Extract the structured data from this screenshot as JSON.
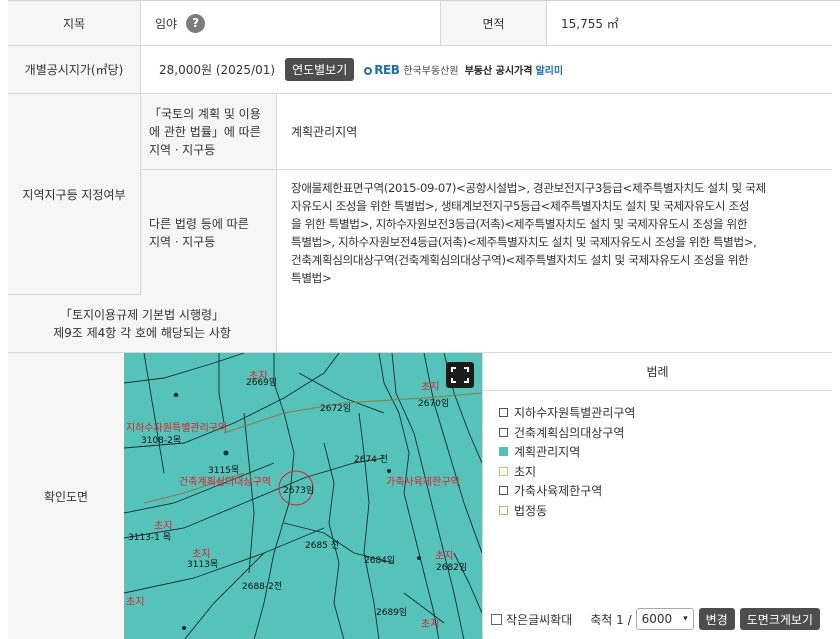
{
  "row1": {
    "label_jimok": "지목",
    "jimok_value": "임야",
    "help_icon_char": "?",
    "label_area": "면적",
    "area_value": "15,755 ㎡"
  },
  "row2": {
    "label_price": "개별공시지가(㎡당)",
    "price_value": "28,000원 (2025/01)",
    "yearly_button": "연도별보기",
    "reb_logo": "REB",
    "reb_name": "한국부동산원",
    "reb_service": "부동산 공시가격",
    "reb_alimi": "알리미"
  },
  "zone": {
    "label": "지역지구등 지정여부",
    "sub1_label_lines": [
      "「국토의 계획 및 이용",
      "에 관한 법률」에 따른",
      "지역ㆍ지구등"
    ],
    "sub1_value": "계획관리지역",
    "sub2_label_lines": [
      "다른 법령 등에 따른",
      "지역ㆍ지구등"
    ],
    "sub2_value_lines": [
      "장애물제한표면구역(2015-09-07)<공항시설법>, 경관보전지구3등급<제주특별자치도 설치 및 국제",
      "자유도시 조성을 위한 특별법>, 생태계보전지구5등급<제주특별자치도 설치 및 국제자유도시 조성",
      "을 위한 특별법>, 지하수자원보전3등급(저촉)<제주특별자치도 설치 및 국제자유도시 조성을 위한",
      "특별법>, 지하수자원보전4등급(저촉)<제주특별자치도 설치 및 국제자유도시 조성을 위한 특별법>,",
      "건축계획심의대상구역(건축계획심의대상구역)<제주특별자치도 설치 및 국제자유도시 조성을 위한",
      "특별법>"
    ]
  },
  "regulation": {
    "label_lines": [
      "「토지이용규제 기본법 시행령」",
      "제9조 제4항 각 호에 해당되는 사항"
    ],
    "value": ""
  },
  "map_row": {
    "label": "확인도면",
    "expand_icon": "expand-icon",
    "map_labels": [
      {
        "text": "초지",
        "color": "#e0202a"
      },
      {
        "text": "2669임",
        "color": "#111"
      },
      {
        "text": "2672임",
        "color": "#111"
      },
      {
        "text": "초지",
        "color": "#e0202a"
      },
      {
        "text": "2670임",
        "color": "#111"
      },
      {
        "text": "지하수자원특별관리구역",
        "color": "#e0202a"
      },
      {
        "text": "3108-2목",
        "color": "#111"
      },
      {
        "text": "3115목",
        "color": "#111"
      },
      {
        "text": "건축계획심의대상구역",
        "color": "#e0202a"
      },
      {
        "text": "2673임",
        "color": "#111"
      },
      {
        "text": "2674 전",
        "color": "#111"
      },
      {
        "text": "가축사육제한구역",
        "color": "#e0202a"
      },
      {
        "text": "초지",
        "color": "#e0202a"
      },
      {
        "text": "3113-1 목",
        "color": "#111"
      },
      {
        "text": "초지",
        "color": "#e0202a"
      },
      {
        "text": "3113목",
        "color": "#111"
      },
      {
        "text": "2685 전",
        "color": "#111"
      },
      {
        "text": "2684임",
        "color": "#111"
      },
      {
        "text": "초지",
        "color": "#e0202a"
      },
      {
        "text": "2682임",
        "color": "#111"
      },
      {
        "text": "2688-2전",
        "color": "#111"
      },
      {
        "text": "초지",
        "color": "#e0202a"
      },
      {
        "text": "2689임",
        "color": "#111"
      },
      {
        "text": "초지",
        "color": "#e0202a"
      }
    ],
    "legend_title": "범례",
    "legend_items": [
      {
        "label": "지하수자원특별관리구역",
        "swatch": "plain"
      },
      {
        "label": "건축계획심의대상구역",
        "swatch": "plain"
      },
      {
        "label": "계획관리지역",
        "swatch": "teal"
      },
      {
        "label": "초지",
        "swatch": "yellow"
      },
      {
        "label": "가축사육제한구역",
        "swatch": "plain"
      },
      {
        "label": "법정동",
        "swatch": "olive"
      }
    ],
    "small_text_label": "작은글씨확대",
    "scale_label": "축척 1 /",
    "scale_value": "6000",
    "change_button": "변경",
    "large_view_button": "도면크게보기"
  },
  "colors": {
    "map_fill": "#55c3b9",
    "zone_red": "#e0202a",
    "button_dark": "#4d4d4d"
  }
}
